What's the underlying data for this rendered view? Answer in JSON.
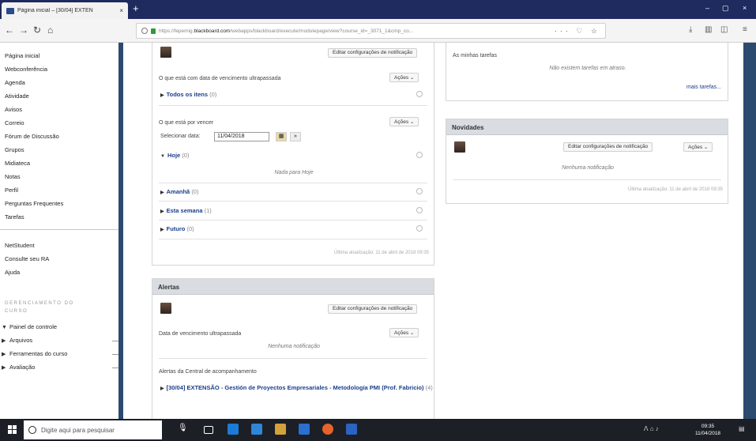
{
  "browser": {
    "tab_title": "Página inicial – [30/04] EXTEN",
    "tab_close": "×",
    "new_tab": "+",
    "window_controls": [
      "–",
      "▢",
      "×"
    ],
    "url_prefix": "https://fepemig.",
    "url_domain": "blackboard.com",
    "url_path": "/webapps/blackboard/execute/modulepage/view?course_id=_3071_1&cmp_co...",
    "url_tools": "··· ♡ ☆",
    "toolbar_icons": [
      "download-icon",
      "library-icon",
      "sidebar-icon",
      "menu-icon"
    ]
  },
  "sidebar": {
    "items": [
      "Página inicial",
      "Webconferência",
      "Agenda",
      "Atividade",
      "Avisos",
      "Correio",
      "Fórum de Discussão",
      "Grupos",
      "Midiateca",
      "Notas",
      "Perfil",
      "Perguntas Frequentes",
      "Tarefas"
    ],
    "items2": [
      "NetStudent",
      "Consulte seu RA",
      "Ajuda"
    ],
    "management_heading": "GERENCIAMENTO DO CURSO",
    "tree": [
      {
        "arrow": "▼",
        "label": "Painel de controle"
      },
      {
        "arrow": "▶",
        "label": "Arquivos"
      },
      {
        "arrow": "▶",
        "label": "Ferramentas do curso"
      },
      {
        "arrow": "▶",
        "label": "Avaliação"
      }
    ]
  },
  "todo_module": {
    "edit_notifications": "Editar configurações de notificação",
    "overdue_title": "O que está com data de vencimento ultrapassada",
    "actions_label": "Ações ⌄",
    "all_items": "Todos os itens",
    "all_items_count": "(0)",
    "upcoming_title": "O que está por vencer",
    "select_date_label": "Selecionar data:",
    "date_value": "11/04/2018",
    "go_label": "»",
    "today": "Hoje",
    "today_count": "(0)",
    "nothing_today": "Nada para Hoje",
    "tomorrow": "Amanhã",
    "tomorrow_count": "(0)",
    "this_week": "Esta semana",
    "this_week_count": "(1)",
    "future": "Futuro",
    "future_count": "(0)",
    "last_updated": "Última atualização: 11 de abril de 2018 09:35"
  },
  "alerts_module": {
    "title": "Alertas",
    "edit_notifications": "Editar configurações de notificação",
    "overdue_title": "Data de vencimento ultrapassada",
    "actions_label": "Ações ⌄",
    "no_notifications": "Nenhuma notificação",
    "tracking_title": "Alertas da Central de acompanhamento",
    "course_link": "[30/04] EXTENSÃO - Gestión de Proyectos Empresariales - Metodología PMI (Prof. Fabricio)",
    "course_count": "(4)"
  },
  "tasks_module": {
    "title": "As minhas tarefas",
    "no_tasks": "Não existem tarefas em atraso.",
    "more_link": "mais tarefas..."
  },
  "news_module": {
    "title": "Novidades",
    "edit_notifications": "Editar configurações de notificação",
    "actions_label": "Ações ⌄",
    "no_notifications": "Nenhuma notificação",
    "last_updated": "Última atualização: 11 de abril de 2018 09:35"
  },
  "taskbar": {
    "search_placeholder": "Digite aqui para pesquisar",
    "tray": "ᐱ  ⌂  ♪",
    "time": "09:35",
    "date": "11/04/2018"
  }
}
